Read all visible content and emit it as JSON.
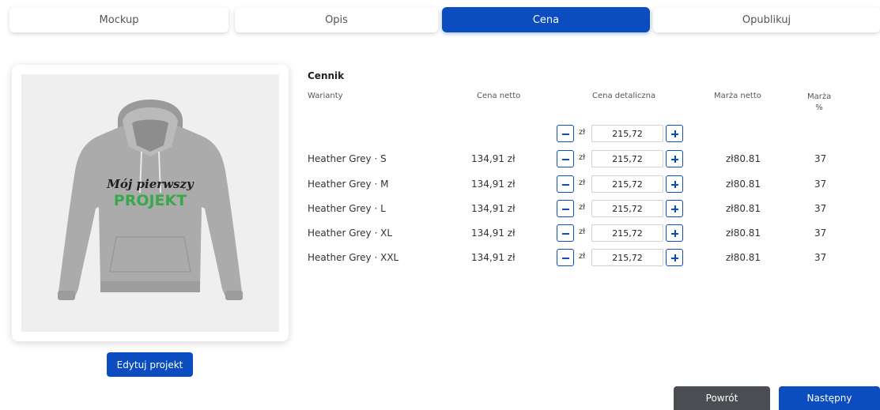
{
  "tabs": [
    {
      "label": "Mockup"
    },
    {
      "label": "Opis"
    },
    {
      "label": "Cena"
    },
    {
      "label": "Opublikuj"
    }
  ],
  "mockup": {
    "print_line1": "Mój pierwszy",
    "print_line2": "PROJEKT",
    "edit_button": "Edytuj projekt"
  },
  "pricing": {
    "title": "Cennik",
    "headers": {
      "variants": "Warianty",
      "net_price": "Cena netto",
      "retail_price": "Cena detaliczna",
      "net_margin": "Marża netto",
      "margin_pct_line1": "Marża",
      "margin_pct_line2": "%"
    },
    "bulk": {
      "currency": "zł",
      "value": "215,72"
    },
    "rows": [
      {
        "variant": "Heather Grey · S",
        "net": "134,91 zł",
        "currency": "zł",
        "retail": "215,72",
        "margin": "zł80.81",
        "pct": "37"
      },
      {
        "variant": "Heather Grey · M",
        "net": "134,91 zł",
        "currency": "zł",
        "retail": "215,72",
        "margin": "zł80.81",
        "pct": "37"
      },
      {
        "variant": "Heather Grey · L",
        "net": "134,91 zł",
        "currency": "zł",
        "retail": "215,72",
        "margin": "zł80.81",
        "pct": "37"
      },
      {
        "variant": "Heather Grey · XL",
        "net": "134,91 zł",
        "currency": "zł",
        "retail": "215,72",
        "margin": "zł80.81",
        "pct": "37"
      },
      {
        "variant": "Heather Grey · XXL",
        "net": "134,91 zł",
        "currency": "zł",
        "retail": "215,72",
        "margin": "zł80.81",
        "pct": "37"
      }
    ]
  },
  "footer": {
    "back": "Powrót",
    "next": "Następny"
  },
  "colors": {
    "accent": "#0b4cc0",
    "dark_button": "#4a4d52",
    "hoodie": "#a9a9a9",
    "print_green": "#3aa84a"
  }
}
